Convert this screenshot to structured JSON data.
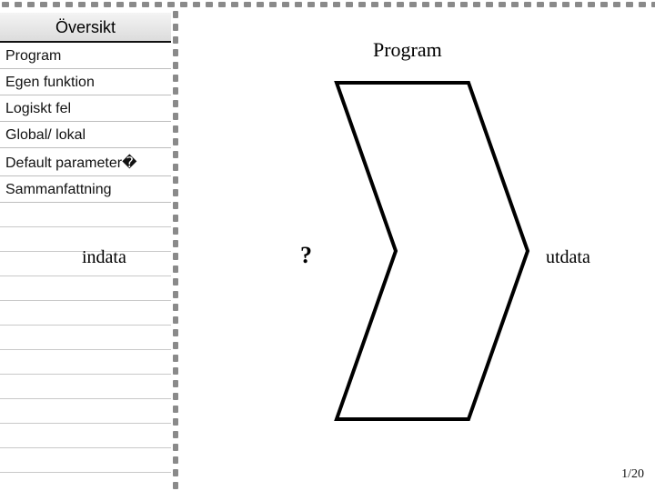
{
  "sidebar": {
    "heading": "Översikt",
    "items": [
      "Program",
      "Egen funktion",
      "Logiskt fel",
      "Global/ lokal",
      "Default parameter�",
      "Sammanfattning"
    ]
  },
  "main": {
    "title": "Program",
    "input_label": "indata",
    "question_mark": "?",
    "output_label": "utdata"
  },
  "page": {
    "current": 1,
    "total": 20,
    "display": "1/20"
  }
}
